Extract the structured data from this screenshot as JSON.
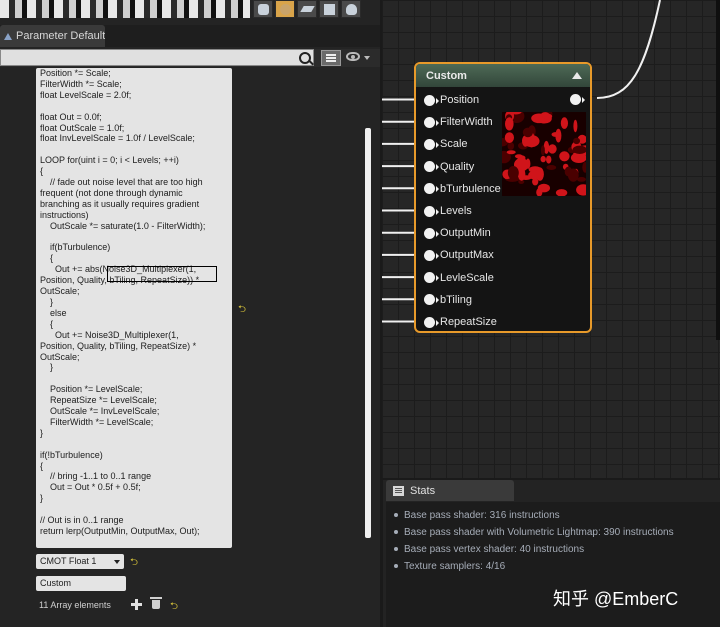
{
  "toolbar": {
    "view_buttons": [
      "cylinder-icon",
      "sphere-icon",
      "plane-icon",
      "cube-icon",
      "teapot-icon"
    ],
    "active_view": "sphere-icon"
  },
  "details": {
    "tab_label": "Parameter Default:",
    "search_placeholder": "",
    "code_lines": [
      "Position *= Scale;",
      "FilterWidth *= Scale;",
      "float LevelScale = 2.0f;",
      "",
      "float Out = 0.0f;",
      "float OutScale = 1.0f;",
      "float InvLevelScale = 1.0f / LevelScale;",
      "",
      "LOOP for(uint i = 0; i < Levels; ++i)",
      "{",
      "    // fade out noise level that are too high",
      "frequent (not done through dynamic",
      "branching as it usually requires gradient",
      "instructions)",
      "    OutScale *= saturate(1.0 - FilterWidth);",
      "",
      "    if(bTurbulence)",
      "    {",
      "      Out += abs(Noise3D_Multiplexer(1,",
      "Position, Quality, bTiling, RepeatSize)) *",
      "OutScale;",
      "    }",
      "    else",
      "    {",
      "      Out += Noise3D_Multiplexer(1,",
      "Position, Quality, bTiling, RepeatSize) *",
      "OutScale;",
      "    }",
      "",
      "    Position *= LevelScale;",
      "    RepeatSize *= LevelScale;",
      "    OutScale *= InvLevelScale;",
      "    FilterWidth *= LevelScale;",
      "}",
      "",
      "if(!bTurbulence)",
      "{",
      "    // bring -1..1 to 0..1 range",
      "    Out = Out * 0.5f + 0.5f;",
      "}",
      "",
      "// Out is in 0..1 range",
      "return lerp(OutputMin, OutputMax, Out);"
    ],
    "output_type": "CMOT Float 1",
    "description": "Custom",
    "array_label": "11 Array elements"
  },
  "node": {
    "title": "Custom",
    "inputs": [
      "Position",
      "FilterWidth",
      "Scale",
      "Quality",
      "bTurbulence",
      "Levels",
      "OutputMin",
      "OutputMax",
      "LevleScale",
      "bTiling",
      "RepeatSize"
    ]
  },
  "stats": {
    "tab_label": "Stats",
    "rows": [
      "Base pass shader: 316 instructions",
      "Base pass shader with Volumetric Lightmap: 390 instructions",
      "Base pass vertex shader: 40 instructions",
      "Texture samplers: 4/16"
    ]
  },
  "watermark": "知乎 @EmberC",
  "colors": {
    "node_border": "#e89a2a",
    "node_header": "#4e6a56",
    "reset_arrow": "#d8c43a",
    "preview_red": "#d0141a"
  }
}
